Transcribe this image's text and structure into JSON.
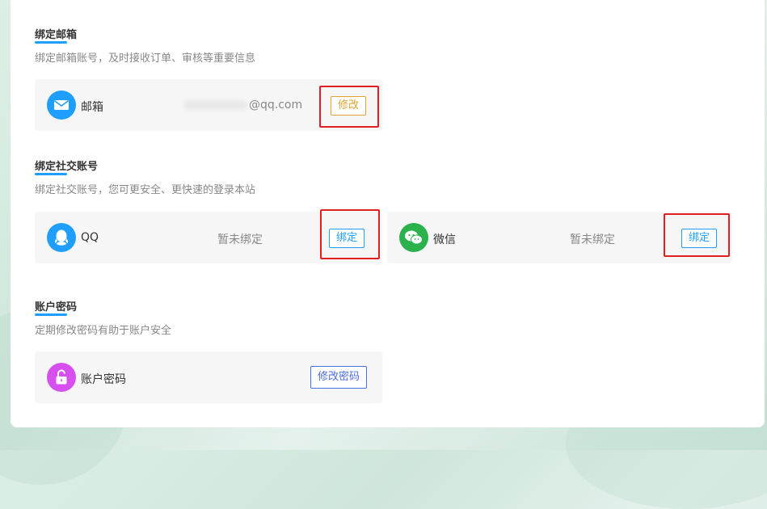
{
  "sections": {
    "email": {
      "title": "绑定邮箱",
      "desc": "绑定邮箱账号，及时接收订单、审核等重要信息",
      "label": "邮箱",
      "value_suffix": "@qq.com",
      "button": "修改"
    },
    "social": {
      "title": "绑定社交账号",
      "desc": "绑定社交账号，您可更安全、更快速的登录本站",
      "qq": {
        "label": "QQ",
        "status": "暂未绑定",
        "button": "绑定"
      },
      "wechat": {
        "label": "微信",
        "status": "暂未绑定",
        "button": "绑定"
      }
    },
    "password": {
      "title": "账户密码",
      "desc": "定期修改密码有助于账户安全",
      "label": "账户密码",
      "button": "修改密码"
    }
  },
  "icons": {
    "email": "mail-icon",
    "qq": "qq-icon",
    "wechat": "wechat-icon",
    "password": "unlock-icon"
  },
  "colors": {
    "accent": "#1e9fff",
    "email_icon": "#1e9fff",
    "qq_icon": "#1e9fff",
    "wechat_icon": "#2bb24c",
    "password_icon": "#d84ff0",
    "highlight": "#e02020",
    "edit_button": "#e0a230"
  }
}
